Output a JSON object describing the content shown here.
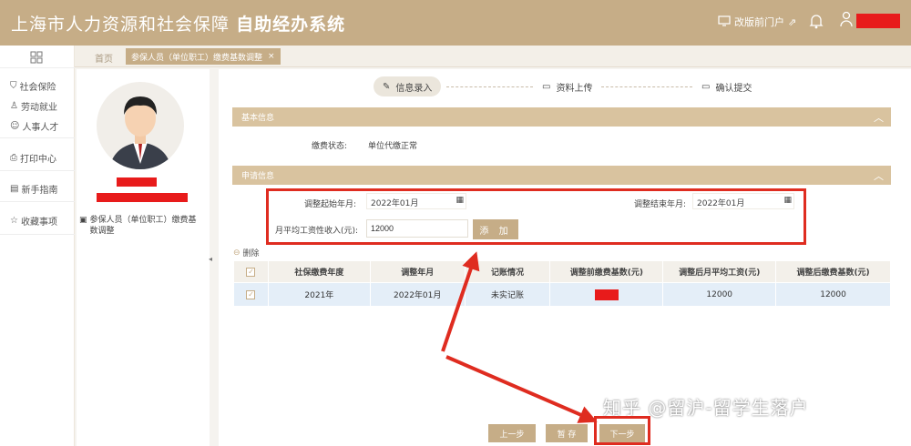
{
  "header": {
    "title_main": "上海市人力资源和社会保障",
    "title_bold": "自助经办系统",
    "portal_link": "改版前门户",
    "bg_color": "#c6ad87"
  },
  "tabs": {
    "home": "首页",
    "active": "参保人员（单位职工）缴费基数调整",
    "close": "×"
  },
  "nav": [
    {
      "label": "社会保险",
      "icon": "shield-icon"
    },
    {
      "label": "劳动就业",
      "icon": "worker-icon"
    },
    {
      "label": "人事人才",
      "icon": "people-icon"
    },
    {
      "label": "打印中心",
      "icon": "printer-icon"
    },
    {
      "label": "新手指南",
      "icon": "guide-icon"
    },
    {
      "label": "收藏事项",
      "icon": "star-icon"
    }
  ],
  "profile": {
    "role": "参保人员（单位职工）缴费基数调整"
  },
  "steps": [
    "信息录入",
    "资料上传",
    "确认提交"
  ],
  "basic": {
    "section_title": "基本信息",
    "status_label": "缴费状态:",
    "status_value": "单位代缴正常"
  },
  "apply": {
    "section_title": "申请信息",
    "start_label": "调整起始年月:",
    "start_value": "2022年01月",
    "end_label": "调整结束年月:",
    "end_value": "2022年01月",
    "income_label": "月平均工资性收入(元):",
    "income_value": "12000",
    "add_button": "添 加"
  },
  "table": {
    "delete_label": "删除",
    "columns": [
      "社保缴费年度",
      "调整年月",
      "记账情况",
      "调整前缴费基数(元)",
      "调整后月平均工资(元)",
      "调整后缴费基数(元)"
    ],
    "rows": [
      [
        "2021年",
        "2022年01月",
        "未实记账",
        "",
        "12000",
        "12000"
      ]
    ]
  },
  "footer": {
    "prev": "上一步",
    "save": "暂 存",
    "next": "下一步"
  },
  "watermark": "知乎 @留沪-留学生落户",
  "accent": "#df2c20"
}
